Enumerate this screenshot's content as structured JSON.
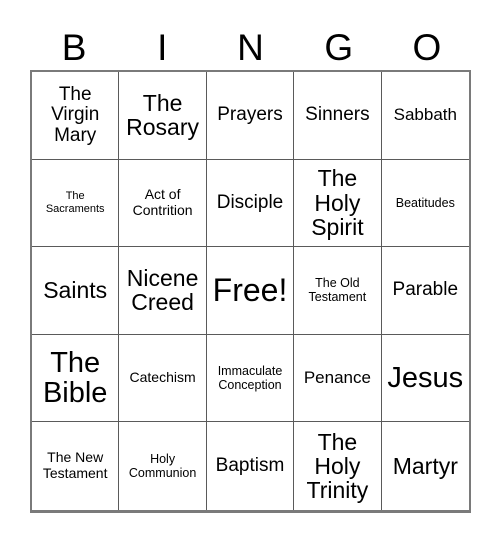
{
  "card": {
    "title": "BINGO",
    "columns": 5,
    "rows": 5,
    "background_color": "#ffffff",
    "text_color": "#000000",
    "border_color": "#5a5a5a",
    "outer_border_color": "#7a7a7a"
  },
  "header": {
    "letters": [
      {
        "label": "B"
      },
      {
        "label": "I"
      },
      {
        "label": "N"
      },
      {
        "label": "G"
      },
      {
        "label": "O"
      }
    ]
  },
  "grid": {
    "cells": [
      {
        "label": "The Virgin Mary",
        "size": "sz-l",
        "free": false
      },
      {
        "label": "The Rosary",
        "size": "sz-xl",
        "free": false
      },
      {
        "label": "Prayers",
        "size": "sz-l",
        "free": false
      },
      {
        "label": "Sinners",
        "size": "sz-l",
        "free": false
      },
      {
        "label": "Sabbath",
        "size": "sz-m",
        "free": false
      },
      {
        "label": "The Sacraments",
        "size": "sz-xxs",
        "free": false
      },
      {
        "label": "Act of Contrition",
        "size": "sz-s",
        "free": false
      },
      {
        "label": "Disciple",
        "size": "sz-l",
        "free": false
      },
      {
        "label": "The Holy Spirit",
        "size": "sz-xl",
        "free": false
      },
      {
        "label": "Beatitudes",
        "size": "sz-xs",
        "free": false
      },
      {
        "label": "Saints",
        "size": "sz-xl",
        "free": false
      },
      {
        "label": "Nicene Creed",
        "size": "sz-xl",
        "free": false
      },
      {
        "label": "Free!",
        "size": "sz-free",
        "free": true
      },
      {
        "label": "The Old Testament",
        "size": "sz-xs",
        "free": false
      },
      {
        "label": "Parable",
        "size": "sz-l",
        "free": false
      },
      {
        "label": "The Bible",
        "size": "sz-xxl",
        "free": false
      },
      {
        "label": "Catechism",
        "size": "sz-s",
        "free": false
      },
      {
        "label": "Immaculate Conception",
        "size": "sz-xs",
        "free": false
      },
      {
        "label": "Penance",
        "size": "sz-m",
        "free": false
      },
      {
        "label": "Jesus",
        "size": "sz-xxl",
        "free": false
      },
      {
        "label": "The New Testament",
        "size": "sz-s",
        "free": false
      },
      {
        "label": "Holy Communion",
        "size": "sz-xs",
        "free": false
      },
      {
        "label": "Baptism",
        "size": "sz-l",
        "free": false
      },
      {
        "label": "The Holy Trinity",
        "size": "sz-xl",
        "free": false
      },
      {
        "label": "Martyr",
        "size": "sz-xl",
        "free": false
      }
    ]
  }
}
